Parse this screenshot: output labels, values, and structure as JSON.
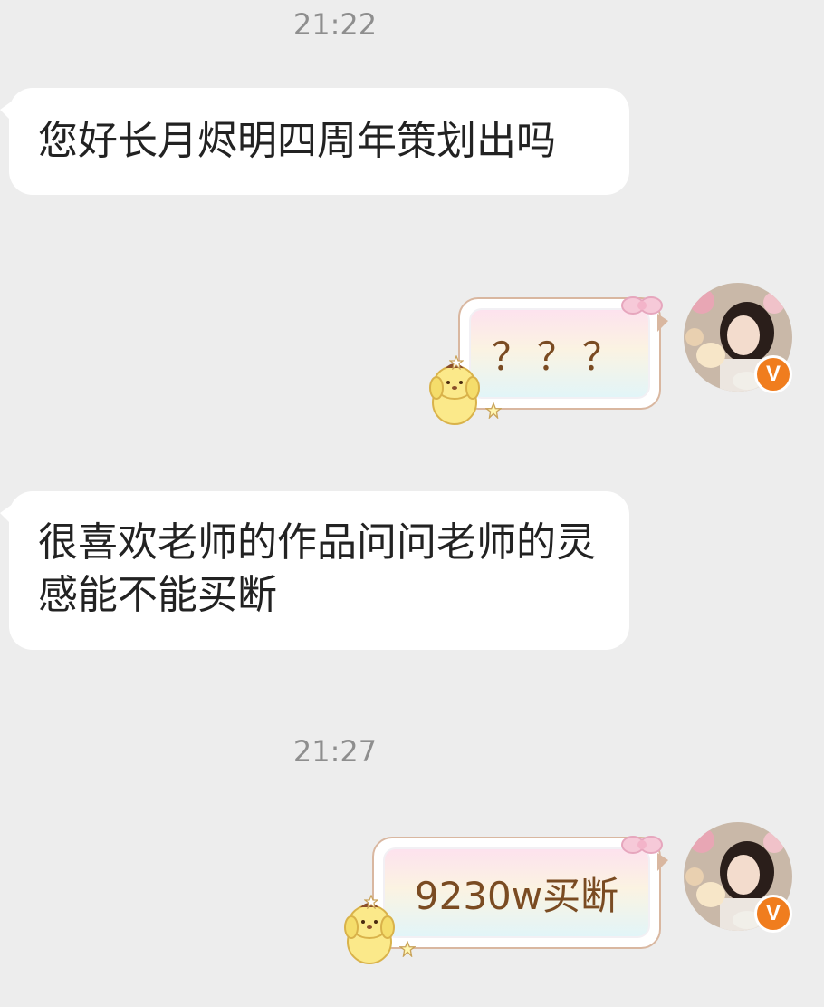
{
  "messages": [
    {
      "type": "time",
      "text": "21:22"
    },
    {
      "type": "incoming",
      "text": "您好长月烬明四周年策划出吗"
    },
    {
      "type": "outgoing",
      "text": "？？？"
    },
    {
      "type": "incoming",
      "text": "很喜欢老师的作品问问老师的灵感能不能买断"
    },
    {
      "type": "time",
      "text": "21:27"
    },
    {
      "type": "outgoing",
      "text": "9230w买断"
    }
  ],
  "avatar": {
    "badge": "V",
    "badge_color": "#f07d1e"
  },
  "colors": {
    "background": "#ededed",
    "incoming_bubble": "#ffffff",
    "outgoing_text": "#7a4b22"
  },
  "icons": [
    "bow-icon",
    "pompompurin-sticker-icon",
    "star-icon",
    "verified-badge-icon"
  ]
}
